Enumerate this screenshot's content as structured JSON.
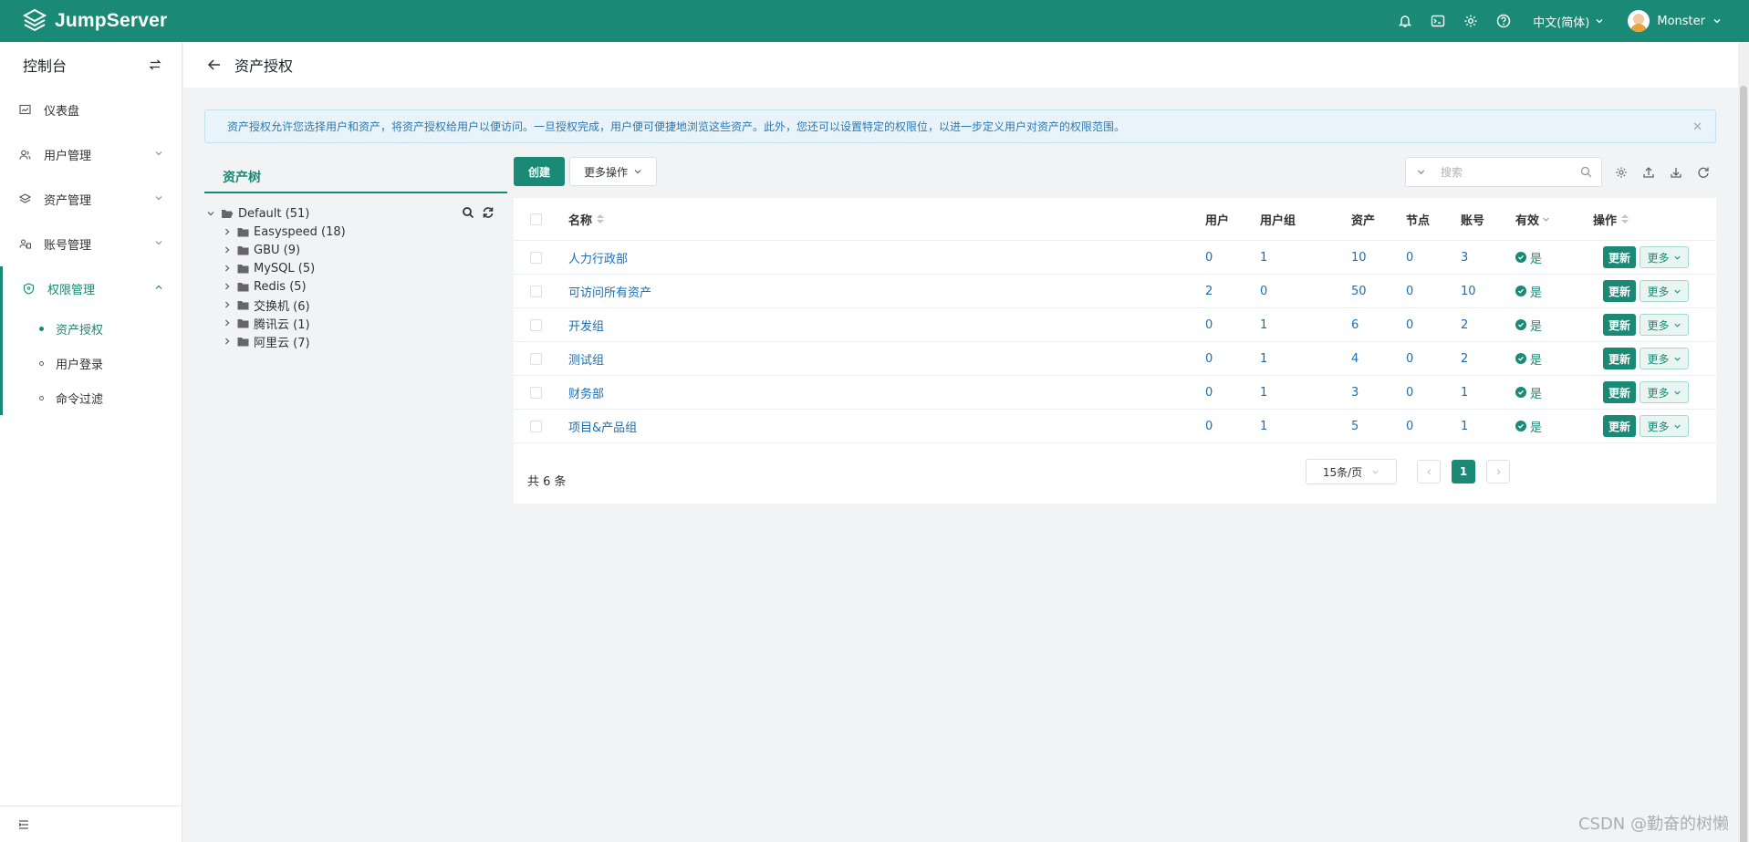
{
  "app": {
    "name": "JumpServer",
    "language": "中文(简体)",
    "username": "Monster"
  },
  "topbar_icons": [
    "bell-icon",
    "terminal-icon",
    "gear-icon",
    "help-icon"
  ],
  "sidebar": {
    "title": "控制台",
    "items": [
      {
        "label": "仪表盘",
        "icon": "dashboard-icon"
      },
      {
        "label": "用户管理",
        "icon": "users-icon"
      },
      {
        "label": "资产管理",
        "icon": "layers-icon"
      },
      {
        "label": "账号管理",
        "icon": "account-icon"
      },
      {
        "label": "权限管理",
        "icon": "shield-icon"
      }
    ],
    "subitems": [
      {
        "label": "资产授权",
        "active": true
      },
      {
        "label": "用户登录",
        "active": false
      },
      {
        "label": "命令过滤",
        "active": false
      }
    ]
  },
  "page": {
    "title": "资产授权"
  },
  "alert": {
    "text": "资产授权允许您选择用户和资产，将资产授权给用户以便访问。一旦授权完成，用户便可便捷地浏览这些资产。此外，您还可以设置特定的权限位，以进一步定义用户对资产的权限范围。"
  },
  "tree": {
    "tab_label": "资产树",
    "root": "Default (51)",
    "nodes": [
      "Easyspeed (18)",
      "GBU (9)",
      "MySQL (5)",
      "Redis (5)",
      "交换机 (6)",
      "腾讯云 (1)",
      "阿里云 (7)"
    ]
  },
  "toolbar": {
    "create_label": "创建",
    "more_label": "更多操作",
    "search_placeholder": "搜索"
  },
  "table": {
    "headers": {
      "name": "名称",
      "users": "用户",
      "user_groups": "用户组",
      "assets": "资产",
      "nodes": "节点",
      "accounts": "账号",
      "valid": "有效",
      "actions": "操作"
    },
    "rows": [
      {
        "name": "人力行政部",
        "users": "0",
        "user_groups": "1",
        "assets": "10",
        "nodes": "0",
        "accounts": "3",
        "valid": "是"
      },
      {
        "name": "可访问所有资产",
        "users": "2",
        "user_groups": "0",
        "assets": "50",
        "nodes": "0",
        "accounts": "10",
        "valid": "是"
      },
      {
        "name": "开发组",
        "users": "0",
        "user_groups": "1",
        "assets": "6",
        "nodes": "0",
        "accounts": "2",
        "valid": "是"
      },
      {
        "name": "测试组",
        "users": "0",
        "user_groups": "1",
        "assets": "4",
        "nodes": "0",
        "accounts": "2",
        "valid": "是"
      },
      {
        "name": "财务部",
        "users": "0",
        "user_groups": "1",
        "assets": "3",
        "nodes": "0",
        "accounts": "1",
        "valid": "是"
      },
      {
        "name": "项目&产品组",
        "users": "0",
        "user_groups": "1",
        "assets": "5",
        "nodes": "0",
        "accounts": "1",
        "valid": "是"
      }
    ],
    "update_label": "更新",
    "more_label": "更多",
    "total_text": "共 6 条",
    "page_size": "15条/页",
    "current_page": "1"
  },
  "watermark": "CSDN @勤奋的树懒",
  "colors": {
    "brand": "#1a8a76",
    "link": "#1a6fb5",
    "alert_bg": "#e9f3fa"
  }
}
